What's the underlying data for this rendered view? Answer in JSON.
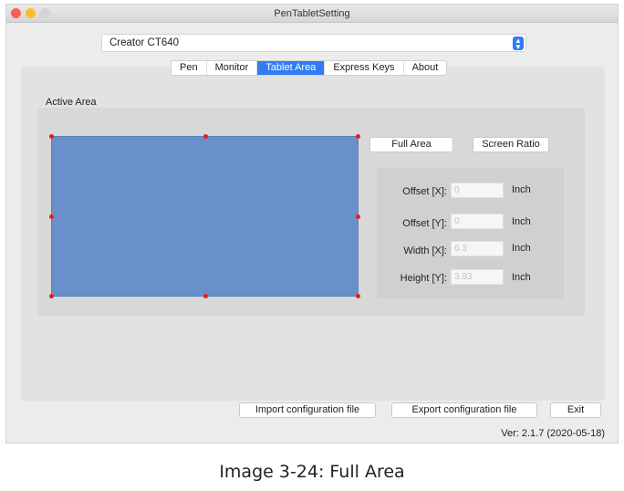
{
  "window": {
    "title": "PenTabletSetting"
  },
  "device_select": {
    "value": "Creator CT640"
  },
  "tabs": [
    {
      "label": "Pen"
    },
    {
      "label": "Monitor"
    },
    {
      "label": "Tablet Area"
    },
    {
      "label": "Express Keys"
    },
    {
      "label": "About"
    }
  ],
  "active_area": {
    "title": "Active Area",
    "full_area": "Full Area",
    "screen_ratio": "Screen Ratio"
  },
  "fields": [
    {
      "label": "Offset [X]:",
      "value": "0",
      "unit": "Inch"
    },
    {
      "label": "Offset [Y]:",
      "value": "0",
      "unit": "Inch"
    },
    {
      "label": "Width [X]:",
      "value": "6.3",
      "unit": "Inch"
    },
    {
      "label": "Height [Y]:",
      "value": "3.93",
      "unit": "Inch"
    }
  ],
  "footer": {
    "import": "Import configuration file",
    "export": "Export configuration file",
    "exit": "Exit",
    "version": "Ver: 2.1.7 (2020-05-18)"
  },
  "caption": "Image 3-24: Full Area"
}
